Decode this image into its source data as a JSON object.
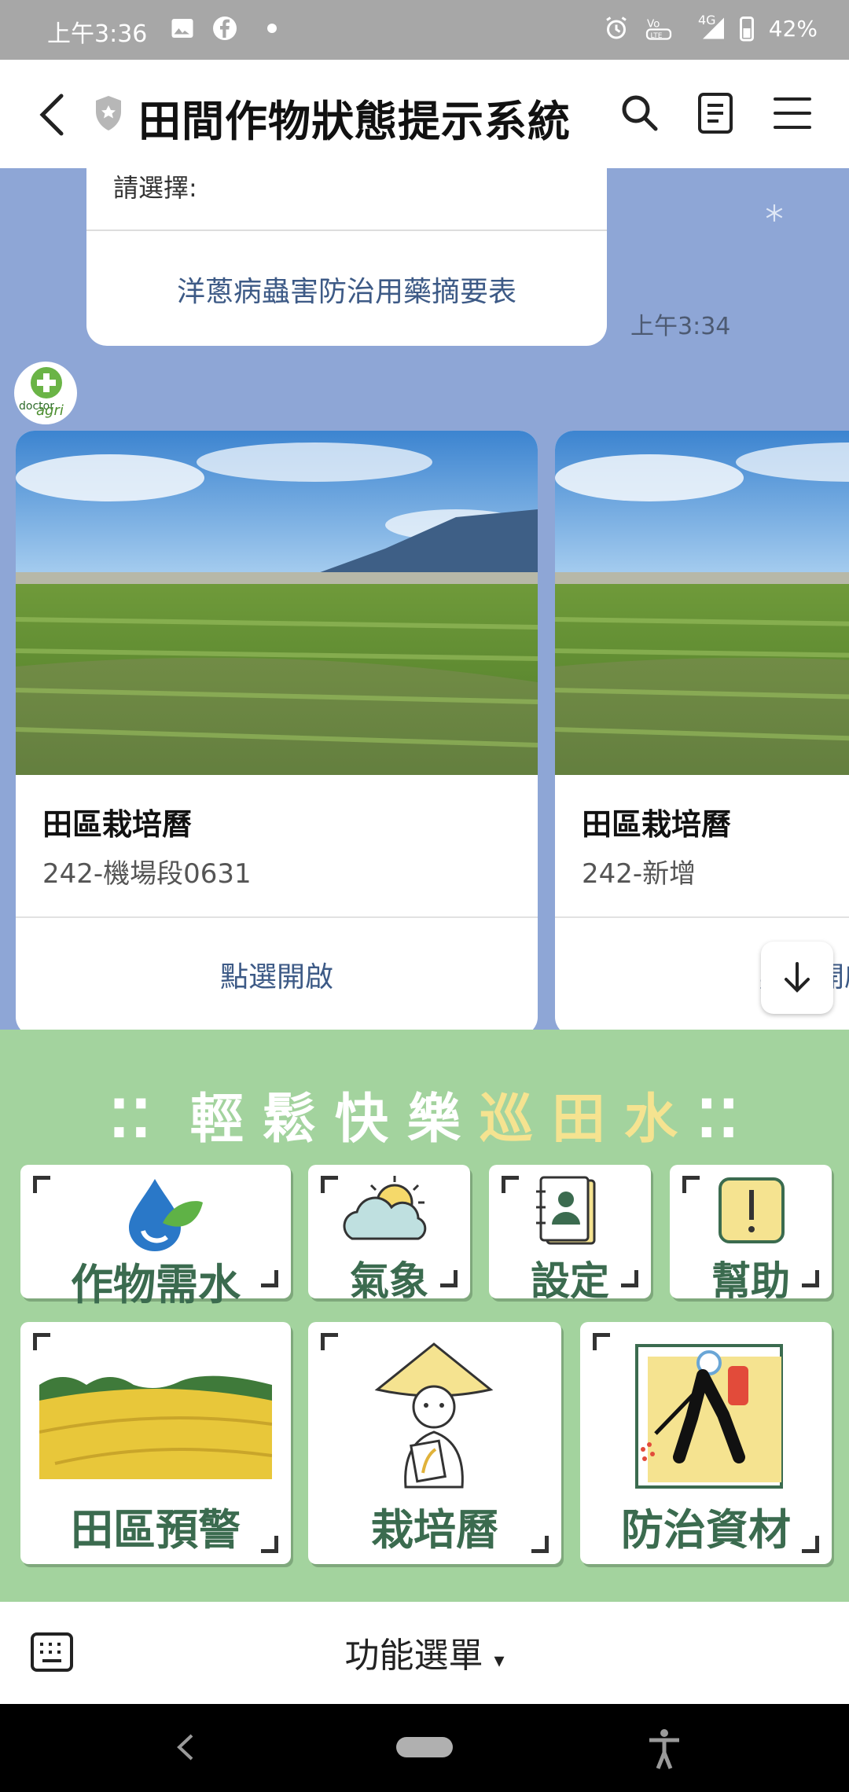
{
  "status_bar": {
    "time": "上午3:36",
    "battery": "42%",
    "network": "4G"
  },
  "header": {
    "title": "田間作物狀態提示系統"
  },
  "chat": {
    "bubble": {
      "prompt": "請選擇:",
      "link": "洋蔥病蟲害防治用藥摘要表"
    },
    "message_time": "上午3:34",
    "avatar": {
      "line1": "doctor",
      "line2": "agri"
    },
    "cards": [
      {
        "title": "田區栽培曆",
        "subtitle": "242-機場段0631",
        "button": "點選開啟"
      },
      {
        "title": "田區栽培曆",
        "subtitle": "242-新增",
        "button": "點選開啟"
      }
    ]
  },
  "rich_menu": {
    "slogan_white": "輕鬆快樂",
    "slogan_yellow": "巡田水",
    "slogan_dots": "⁚⁚",
    "tiles": {
      "water": "作物需水",
      "weather": "氣象",
      "settings": "設定",
      "help": "幫助",
      "field_alert": "田區預警",
      "calendar": "栽培曆",
      "materials": "防治資材"
    }
  },
  "input_bar": {
    "menu_label": "功能選單",
    "menu_arrow": "▾"
  },
  "colors": {
    "chat_bg": "#8ea6d6",
    "menu_bg": "#a3d39e",
    "link": "#3d5a86",
    "tile_text": "#3b6b4f",
    "slogan_yellow": "#f5e390"
  }
}
